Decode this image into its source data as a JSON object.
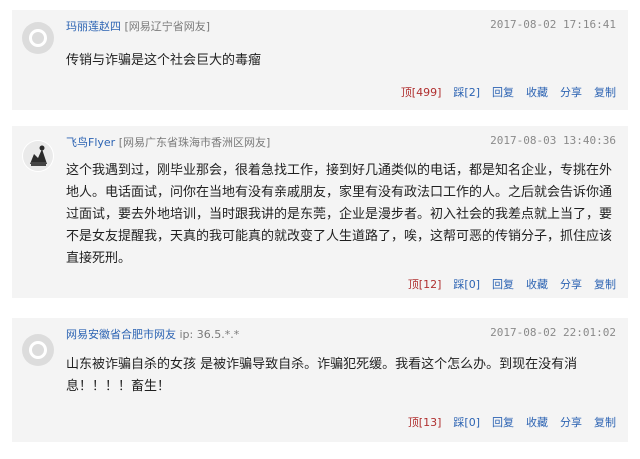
{
  "comments": [
    {
      "user": "玛丽莲赵四",
      "location": "[网易辽宁省网友]",
      "time": "2017-08-02 17:16:41",
      "content": "传销与诈骗是这个社会巨大的毒瘤",
      "up": "顶[499]",
      "down": "踩[2]",
      "reply": "回复",
      "favorite": "收藏",
      "share": "分享",
      "copy": "复制"
    },
    {
      "user": "飞鸟Flyer",
      "location": "[网易广东省珠海市香洲区网友]",
      "time": "2017-08-03 13:40:36",
      "content": "这个我遇到过，刚毕业那会，很着急找工作，接到好几通类似的电话，都是知名企业，专挑在外地人。电话面试，问你在当地有没有亲戚朋友，家里有没有政法口工作的人。之后就会告诉你通过面试，要去外地培训，当时跟我讲的是东莞，企业是漫步者。初入社会的我差点就上当了，要不是女友提醒我，天真的我可能真的就改变了人生道路了，唉，这帮可恶的传销分子，抓住应该直接死刑。",
      "up": "顶[12]",
      "down": "踩[0]",
      "reply": "回复",
      "favorite": "收藏",
      "share": "分享",
      "copy": "复制"
    },
    {
      "user": "网易安徽省合肥市网友",
      "location": "ip: 36.5.*.*",
      "time": "2017-08-02 22:01:02",
      "content": "山东被诈骗自杀的女孩 是被诈骗导致自杀。诈骗犯死缓。我看这个怎么办。到现在没有消息！！！！畜生！",
      "up": "顶[13]",
      "down": "踩[0]",
      "reply": "回复",
      "favorite": "收藏",
      "share": "分享",
      "copy": "复制"
    }
  ]
}
